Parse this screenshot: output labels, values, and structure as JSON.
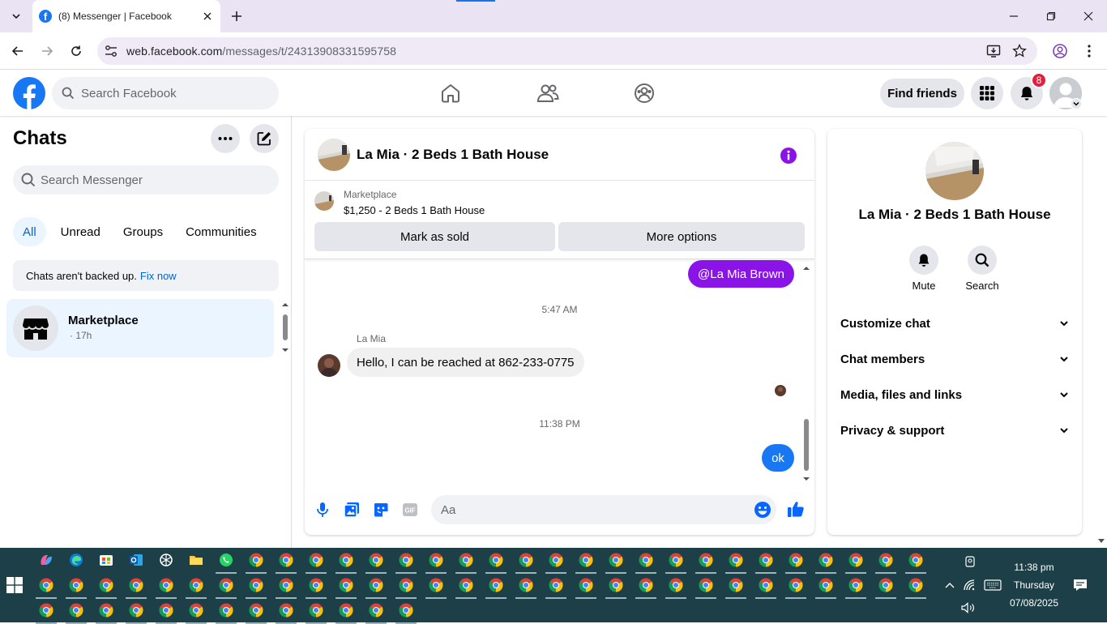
{
  "browser": {
    "tab_title": "(8) Messenger | Facebook",
    "url_host": "web.facebook.com",
    "url_path": "/messages/t/24313908331595758"
  },
  "fb_header": {
    "search_placeholder": "Search Facebook",
    "find_friends": "Find friends",
    "notification_count": "8",
    "brand_color": "#1877f2"
  },
  "chats": {
    "title": "Chats",
    "search_placeholder": "Search Messenger",
    "filters": [
      "All",
      "Unread",
      "Groups",
      "Communities"
    ],
    "active_filter": "All",
    "backup_text": "Chats aren't backed up.",
    "backup_link": "Fix now",
    "items": [
      {
        "name": "Marketplace",
        "time": "· 17h"
      }
    ]
  },
  "conversation": {
    "title": "La Mia · 2 Beds 1 Bath House",
    "marketplace_label": "Marketplace",
    "listing": "$1,250 - 2 Beds 1 Bath House",
    "mark_sold": "Mark as sold",
    "more_options": "More options",
    "messages": {
      "mention": "@La Mia Brown",
      "stamp1": "5:47 AM",
      "sender": "La Mia",
      "incoming": "Hello, I can be reached at 862-233-0775",
      "stamp2": "11:38 PM",
      "outgoing": "ok"
    },
    "composer_placeholder": "Aa",
    "accent_color": "#8a14e8"
  },
  "info": {
    "title": "La Mia · 2 Beds 1 Bath House",
    "mute": "Mute",
    "search": "Search",
    "sections": [
      "Customize chat",
      "Chat members",
      "Media, files and links",
      "Privacy & support"
    ]
  },
  "taskbar": {
    "time": "11:38 pm",
    "day": "Thursday",
    "date": "07/08/2025"
  }
}
